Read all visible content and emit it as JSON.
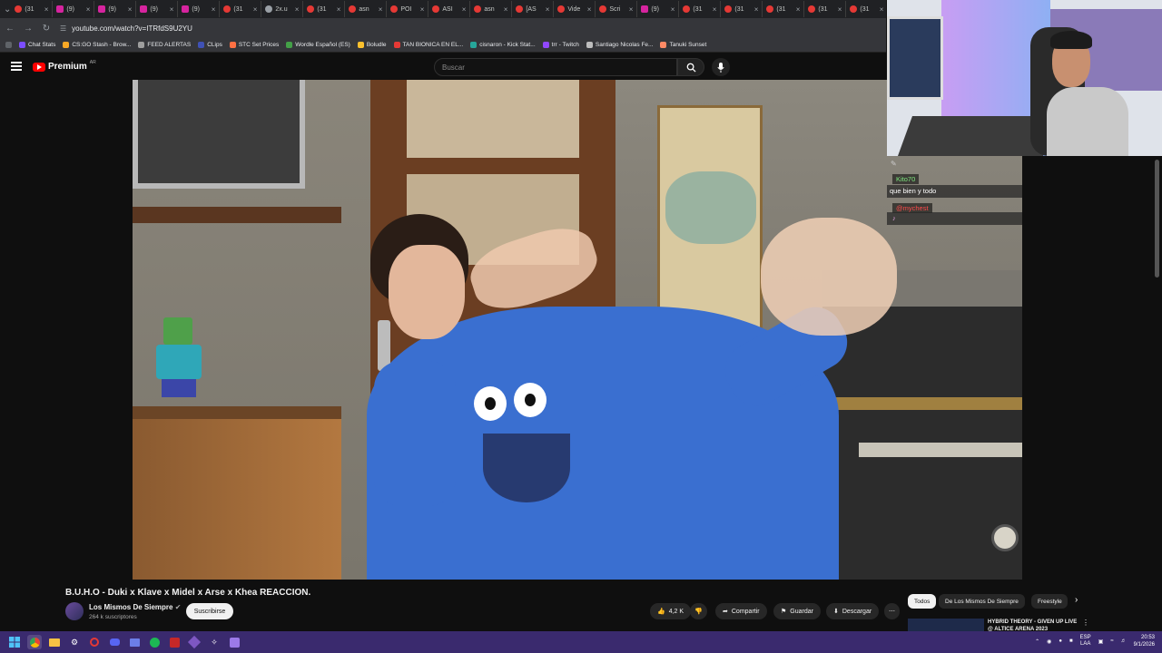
{
  "browser": {
    "tabs": [
      {
        "label": "(31",
        "kind": "yt"
      },
      {
        "label": "(9)",
        "kind": "ig"
      },
      {
        "label": "(9)",
        "kind": "ig"
      },
      {
        "label": "(9)",
        "kind": "ig"
      },
      {
        "label": "(9)",
        "kind": "ig"
      },
      {
        "label": "(31",
        "kind": "yt"
      },
      {
        "label": "2x.u",
        "kind": "gray"
      },
      {
        "label": "(31",
        "kind": "yt"
      },
      {
        "label": "asn",
        "kind": "yt"
      },
      {
        "label": "POI",
        "kind": "yt"
      },
      {
        "label": "ASI",
        "kind": "yt"
      },
      {
        "label": "asn",
        "kind": "yt"
      },
      {
        "label": "[AS",
        "kind": "yt"
      },
      {
        "label": "Vide",
        "kind": "yt"
      },
      {
        "label": "Scri",
        "kind": "yt"
      },
      {
        "label": "(9)",
        "kind": "ig"
      },
      {
        "label": "(31",
        "kind": "yt"
      },
      {
        "label": "(31",
        "kind": "yt"
      },
      {
        "label": "(31",
        "kind": "yt"
      },
      {
        "label": "(31",
        "kind": "yt"
      },
      {
        "label": "(31",
        "kind": "yt"
      }
    ],
    "url": "youtube.com/watch?v=ITRfdS9U2YU",
    "bookmarks": [
      "Chat Stats",
      "CS:GO Stash - Brow...",
      "FEED ALERTAS",
      "CLips",
      "STC Set Prices",
      "Wordle Español (ES)",
      "Boludle",
      "TAN BIONICA EN EL...",
      "cisnaron - Kick Stat...",
      "trr - Twitch",
      "Santiago Nicolas Fe...",
      "Tanuki Sunset"
    ]
  },
  "youtube": {
    "logo_text": "Premium",
    "logo_region": "AR",
    "search_placeholder": "Buscar",
    "video_title": "B.U.H.O - Duki x Klave x Midel x Arse x Khea REACCION.",
    "channel_name": "Los Mismos De Siempre",
    "subscribers": "264 k suscriptores",
    "subscribe_label": "Suscribirse",
    "likes": "4,2 K",
    "share_label": "Compartir",
    "save_label": "Guardar",
    "download_label": "Descargar",
    "chips": [
      "Todos",
      "De Los Mismos De Siempre",
      "Freestyle"
    ],
    "recommended_title": "HYBRID THEORY - GIVEN UP LIVE @ ALTICE ARENA 2023"
  },
  "stream_overlay": {
    "chat": [
      {
        "user": "Kito70",
        "message": "que bien y todo",
        "user_color": "#7ee87e"
      },
      {
        "user": "@mychest",
        "message": "",
        "user_color": "#ff4a4a"
      }
    ]
  },
  "taskbar": {
    "lang_top": "ESP",
    "lang_bottom": "LAA",
    "time": "20:53",
    "date": "9/1/2026"
  },
  "colors": {
    "accent_red": "#ff0000",
    "taskbar": "#3a2a6e",
    "yt_bg": "#0f0f0f"
  }
}
